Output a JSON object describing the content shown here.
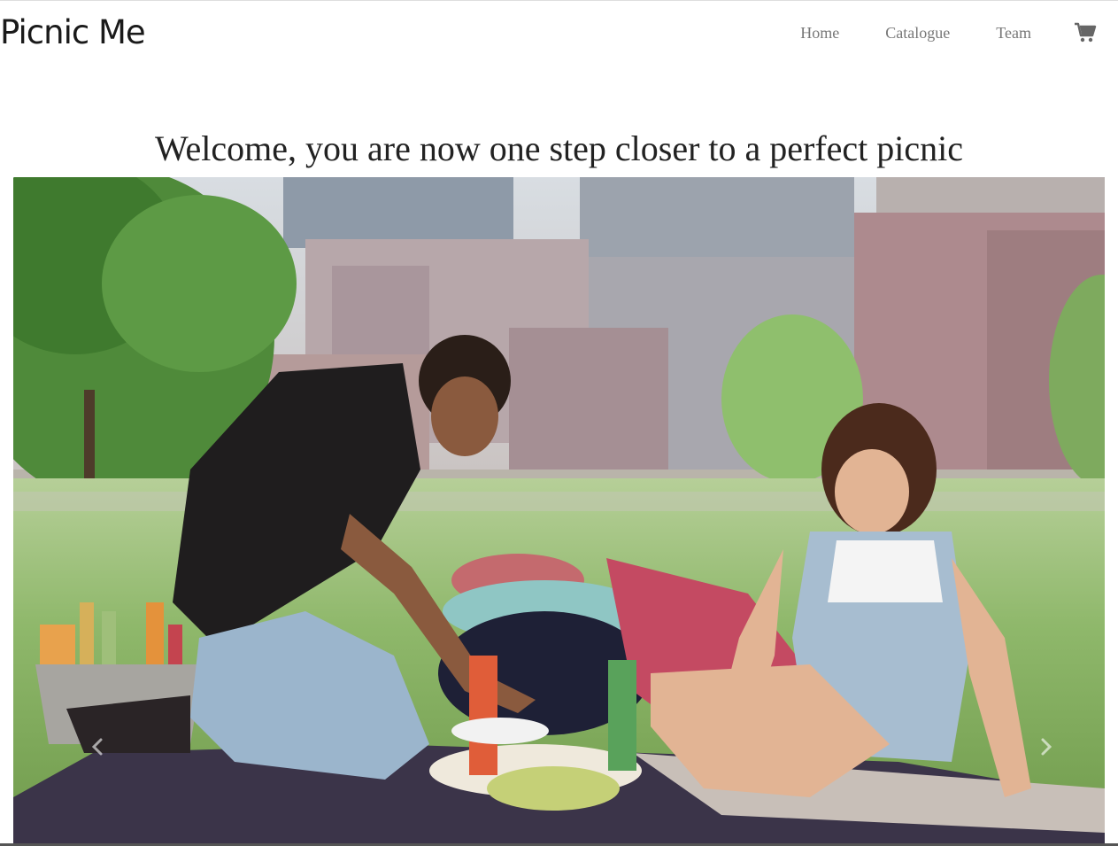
{
  "navbar": {
    "brand": "Picnic Me",
    "links": [
      {
        "label": "Home"
      },
      {
        "label": "Catalogue"
      },
      {
        "label": "Team"
      }
    ],
    "cart_icon": "shopping-cart-icon"
  },
  "hero": {
    "title": "Welcome, you are now one step closer to a perfect picnic"
  },
  "carousel": {
    "prev_icon": "chevron-left-icon",
    "next_icon": "chevron-right-icon",
    "slide_image": "couple-picnic-in-park-photo"
  },
  "colors": {
    "brand_text": "#1a1a1a",
    "nav_text": "#777777",
    "title_text": "#222222"
  }
}
